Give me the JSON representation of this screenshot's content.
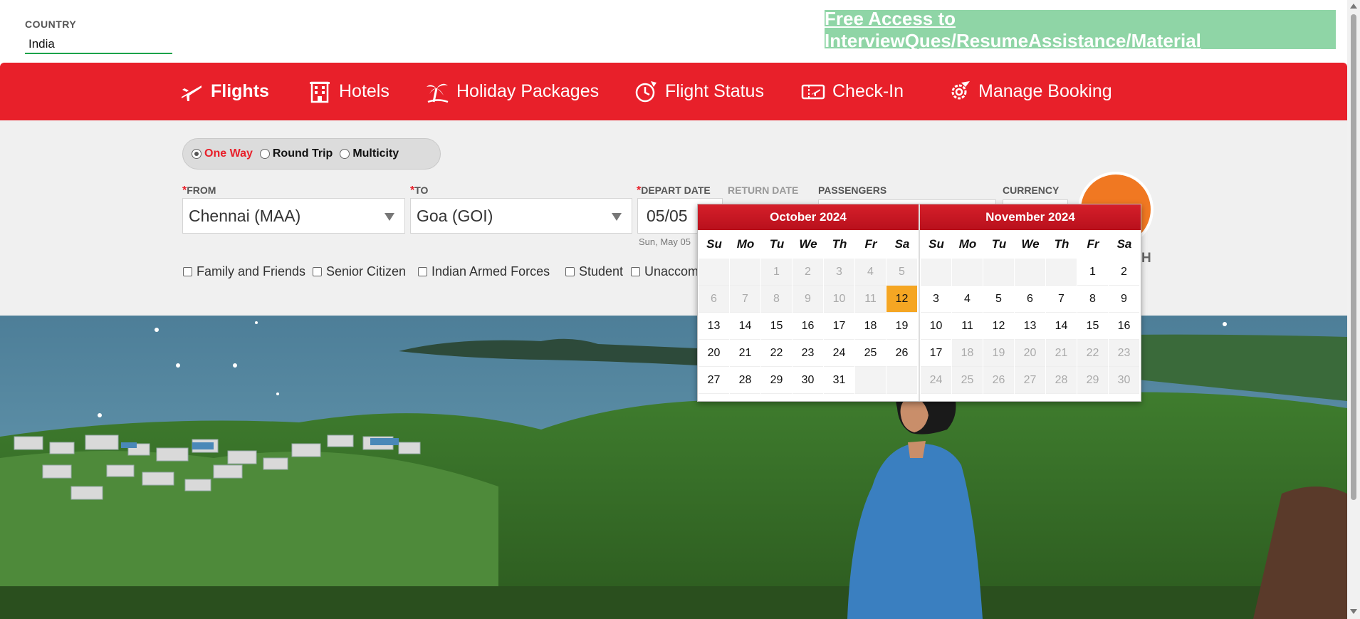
{
  "country": {
    "label": "COUNTRY",
    "value": "India"
  },
  "promo": {
    "text": "Free Access to InterviewQues/ResumeAssistance/Material"
  },
  "nav": [
    {
      "label": "Flights",
      "icon": "plane-icon",
      "active": true
    },
    {
      "label": "Hotels",
      "icon": "hotel-icon"
    },
    {
      "label": "Holiday Packages",
      "icon": "palm-tree-icon"
    },
    {
      "label": "Flight Status",
      "icon": "flight-status-icon"
    },
    {
      "label": "Check-In",
      "icon": "ticket-icon"
    },
    {
      "label": "Manage Booking",
      "icon": "gear-plane-icon"
    }
  ],
  "trip_types": [
    {
      "label": "One Way",
      "selected": true
    },
    {
      "label": "Round Trip"
    },
    {
      "label": "Multicity"
    }
  ],
  "form": {
    "from_label": "FROM",
    "to_label": "TO",
    "depart_label": "DEPART DATE",
    "return_label": "RETURN DATE",
    "passengers_label": "PASSENGERS",
    "currency_label": "CURRENCY",
    "required_marker": "*",
    "from_value": "Chennai (MAA)",
    "to_value": "Goa (GOI)",
    "depart_value": "05/05",
    "depart_sub": "Sun, May 05",
    "search_tail": "H"
  },
  "concessions": [
    "Family and Friends",
    "Senior Citizen",
    "Indian Armed Forces",
    "Student",
    "Unaccom"
  ],
  "calendar": {
    "day_names": [
      "Su",
      "Mo",
      "Tu",
      "We",
      "Th",
      "Fr",
      "Sa"
    ],
    "months": [
      {
        "title": "October 2024",
        "weeks": [
          [
            {
              "d": ""
            },
            {
              "d": ""
            },
            {
              "d": "1",
              "s": "dis"
            },
            {
              "d": "2",
              "s": "dis"
            },
            {
              "d": "3",
              "s": "dis"
            },
            {
              "d": "4",
              "s": "dis"
            },
            {
              "d": "5",
              "s": "dis"
            }
          ],
          [
            {
              "d": "6",
              "s": "dis"
            },
            {
              "d": "7",
              "s": "dis"
            },
            {
              "d": "8",
              "s": "dis"
            },
            {
              "d": "9",
              "s": "dis"
            },
            {
              "d": "10",
              "s": "dis"
            },
            {
              "d": "11",
              "s": "dis"
            },
            {
              "d": "12",
              "s": "sel"
            }
          ],
          [
            {
              "d": "13"
            },
            {
              "d": "14"
            },
            {
              "d": "15"
            },
            {
              "d": "16"
            },
            {
              "d": "17"
            },
            {
              "d": "18"
            },
            {
              "d": "19"
            }
          ],
          [
            {
              "d": "20"
            },
            {
              "d": "21"
            },
            {
              "d": "22"
            },
            {
              "d": "23"
            },
            {
              "d": "24"
            },
            {
              "d": "25"
            },
            {
              "d": "26"
            }
          ],
          [
            {
              "d": "27"
            },
            {
              "d": "28"
            },
            {
              "d": "29"
            },
            {
              "d": "30"
            },
            {
              "d": "31"
            },
            {
              "d": ""
            },
            {
              "d": ""
            }
          ]
        ]
      },
      {
        "title": "November 2024",
        "weeks": [
          [
            {
              "d": ""
            },
            {
              "d": ""
            },
            {
              "d": ""
            },
            {
              "d": ""
            },
            {
              "d": ""
            },
            {
              "d": "1"
            },
            {
              "d": "2"
            }
          ],
          [
            {
              "d": "3"
            },
            {
              "d": "4"
            },
            {
              "d": "5"
            },
            {
              "d": "6"
            },
            {
              "d": "7"
            },
            {
              "d": "8"
            },
            {
              "d": "9"
            }
          ],
          [
            {
              "d": "10"
            },
            {
              "d": "11"
            },
            {
              "d": "12"
            },
            {
              "d": "13"
            },
            {
              "d": "14"
            },
            {
              "d": "15"
            },
            {
              "d": "16"
            }
          ],
          [
            {
              "d": "17"
            },
            {
              "d": "18",
              "s": "dis"
            },
            {
              "d": "19",
              "s": "dis"
            },
            {
              "d": "20",
              "s": "dis"
            },
            {
              "d": "21",
              "s": "dis"
            },
            {
              "d": "22",
              "s": "dis"
            },
            {
              "d": "23",
              "s": "dis"
            }
          ],
          [
            {
              "d": "24",
              "s": "dis"
            },
            {
              "d": "25",
              "s": "dis"
            },
            {
              "d": "26",
              "s": "dis"
            },
            {
              "d": "27",
              "s": "dis"
            },
            {
              "d": "28",
              "s": "dis"
            },
            {
              "d": "29",
              "s": "dis"
            },
            {
              "d": "30",
              "s": "dis"
            }
          ]
        ]
      }
    ]
  },
  "colors": {
    "brand_red": "#e8202a",
    "promo_green": "#8fd5a6",
    "selected_day": "#f5a623",
    "search_orange": "#f07822"
  }
}
